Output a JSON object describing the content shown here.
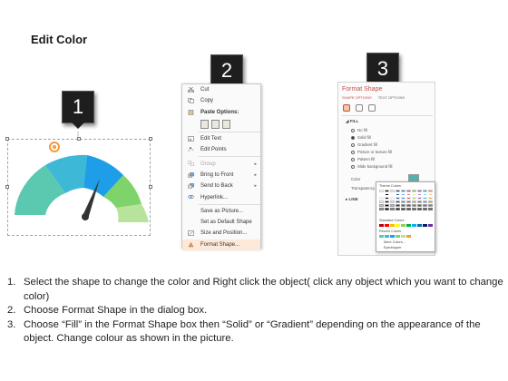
{
  "title": "Edit Color",
  "callouts": [
    "1",
    "2",
    "3"
  ],
  "gauge": {
    "colors": [
      "#5bc9b0",
      "#3db8d6",
      "#1e9ee8",
      "#7ed36b",
      "#b8e39a"
    ],
    "needle_color": "#333333",
    "target_icon_color": "#f39c3c"
  },
  "context_menu": {
    "items": [
      {
        "label": "Cut",
        "icon": "scissors-icon"
      },
      {
        "label": "Copy",
        "icon": "copy-icon"
      },
      {
        "label": "Paste Options:",
        "icon": "paste-icon"
      },
      {
        "label": "Edit Text",
        "icon": "edit-text-icon"
      },
      {
        "label": "Edit Points",
        "icon": "edit-points-icon"
      },
      {
        "label": "Group",
        "icon": "group-icon"
      },
      {
        "label": "Bring to Front",
        "icon": "bring-front-icon"
      },
      {
        "label": "Send to Back",
        "icon": "send-back-icon"
      },
      {
        "label": "Hyperlink...",
        "icon": "hyperlink-icon"
      },
      {
        "label": "Save as Picture...",
        "icon": ""
      },
      {
        "label": "Set as Default Shape",
        "icon": ""
      },
      {
        "label": "Size and Position...",
        "icon": "size-position-icon"
      },
      {
        "label": "Format Shape...",
        "icon": "format-shape-icon"
      }
    ]
  },
  "format_shape": {
    "title": "Format Shape",
    "tabs": [
      "SHAPE OPTIONS",
      "TEXT OPTIONS"
    ],
    "fill_section": "FILL",
    "fill_options": [
      "No fill",
      "Solid fill",
      "Gradient fill",
      "Picture or texture fill",
      "Pattern fill",
      "Slide background fill"
    ],
    "selected_fill": "Solid fill",
    "color_label": "Color",
    "transparency_label": "Transparency",
    "line_section": "LINE",
    "palette": {
      "theme_label": "Theme Colors",
      "standard_label": "Standard Colors",
      "recent_label": "Recent Colors",
      "more_colors": "More Colors...",
      "eyedropper": "Eyedropper"
    }
  },
  "steps": [
    {
      "num": "1.",
      "text": "Select the shape to change the color and Right click the object( click any object which you want to change color)"
    },
    {
      "num": "2.",
      "text": "Choose Format Shape in the dialog box."
    },
    {
      "num": "3.",
      "text": "Choose “Fill” in the Format Shape box then “Solid” or “Gradient” depending on the appearance of the object. Change colour as shown in the picture."
    }
  ]
}
